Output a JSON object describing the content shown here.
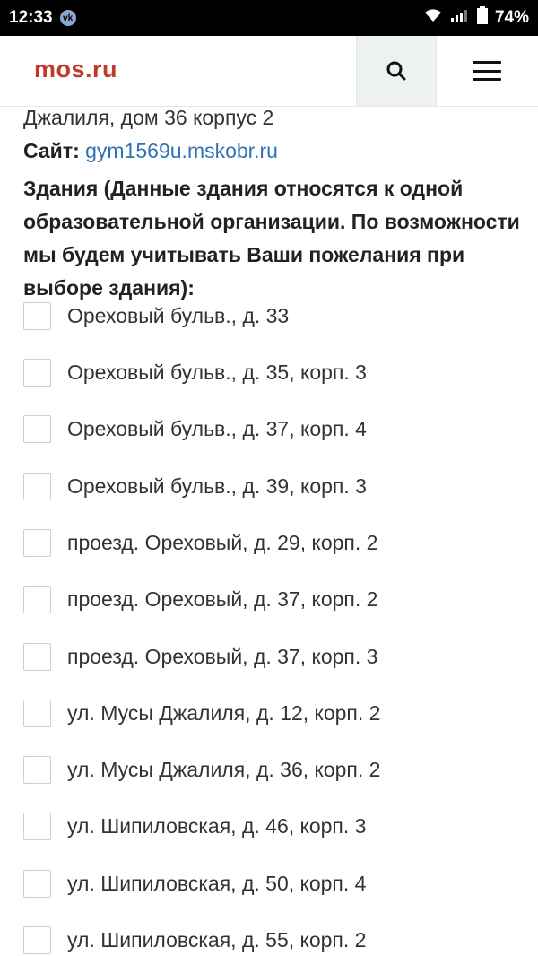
{
  "status_bar": {
    "time": "12:33",
    "app_icon": "vk-icon",
    "battery": "74%"
  },
  "header": {
    "logo": "mos.ru",
    "search_icon": "search-icon",
    "menu_icon": "hamburger-menu-icon"
  },
  "content": {
    "address_line": "Джалиля, дом 36 корпус 2",
    "site_label": "Сайт:",
    "site_url": "gym1569u.mskobr.ru",
    "buildings_title": "Здания (Данные здания относятся к одной образовательной организации. По возможности мы будем учитывать Ваши пожелания при выборе здания):",
    "options": [
      {
        "label": "Ореховый бульв., д. 33",
        "checked": false
      },
      {
        "label": "Ореховый бульв., д. 35, корп. 3",
        "checked": false
      },
      {
        "label": "Ореховый бульв., д. 37, корп. 4",
        "checked": false
      },
      {
        "label": "Ореховый бульв., д. 39, корп. 3",
        "checked": false
      },
      {
        "label": "проезд. Ореховый, д. 29, корп. 2",
        "checked": false
      },
      {
        "label": "проезд. Ореховый, д. 37, корп. 2",
        "checked": false
      },
      {
        "label": "проезд. Ореховый, д. 37, корп. 3",
        "checked": false
      },
      {
        "label": "ул. Мусы Джалиля, д. 12, корп. 2",
        "checked": false
      },
      {
        "label": "ул. Мусы Джалиля, д. 36, корп. 2",
        "checked": false
      },
      {
        "label": "ул. Шипиловская, д. 46, корп. 3",
        "checked": false
      },
      {
        "label": "ул. Шипиловская, д. 50, корп. 4",
        "checked": false
      },
      {
        "label": "ул. Шипиловская, д. 55, корп. 2",
        "checked": false
      }
    ]
  }
}
